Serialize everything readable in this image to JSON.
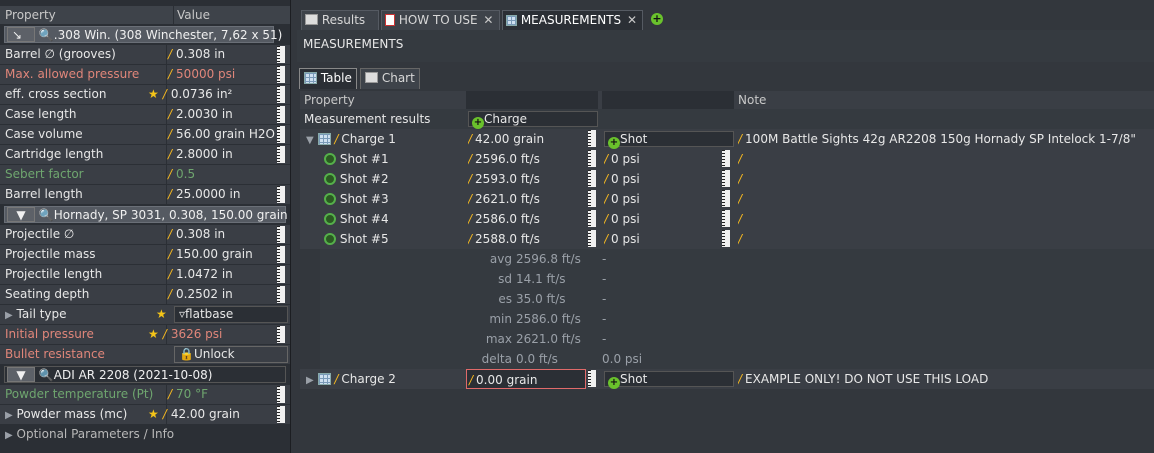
{
  "left": {
    "headers": {
      "property": "Property",
      "value": "Value"
    },
    "cartridge": {
      "label": ".308 Win. (308 Winchester, 7,62 x 51)"
    },
    "cartridge_rows": [
      {
        "name": "Barrel ∅ (grooves)",
        "value": "0.308 in"
      },
      {
        "name": "Max. allowed pressure",
        "value": "50000 psi"
      },
      {
        "name": "eff. cross section",
        "value": "0.0736 in²"
      },
      {
        "name": "Case length",
        "value": "2.0030 in"
      },
      {
        "name": "Case volume",
        "value": "56.00 grain H2O"
      },
      {
        "name": "Cartridge length",
        "value": "2.8000 in"
      },
      {
        "name": "Sebert factor",
        "value": "0.5"
      },
      {
        "name": "Barrel length",
        "value": "25.0000 in"
      }
    ],
    "projectile": {
      "label": "Hornady, SP 3031, 0.308, 150.00 grain"
    },
    "projectile_rows": [
      {
        "name": "Projectile ∅",
        "value": "0.308 in"
      },
      {
        "name": "Projectile mass",
        "value": "150.00 grain"
      },
      {
        "name": "Projectile length",
        "value": "1.0472 in"
      },
      {
        "name": "Seating depth",
        "value": "0.2502 in"
      }
    ],
    "tail_type": {
      "name": "Tail type",
      "value": "flatbase"
    },
    "initial_pressure": {
      "name": "Initial pressure",
      "value": "3626 psi"
    },
    "bullet_resistance": {
      "name": "Bullet resistance",
      "value": "Unlock"
    },
    "powder": {
      "label": "ADI AR 2208 (2021-10-08)"
    },
    "powder_temp": {
      "name": "Powder temperature (Pt)",
      "value": "70 °F"
    },
    "powder_mass": {
      "name": "Powder mass (mc)",
      "value": "42.00 grain"
    },
    "optional": "Optional Parameters / Info"
  },
  "tabs": [
    {
      "label": "Results"
    },
    {
      "label": "HOW TO USE"
    },
    {
      "label": "MEASUREMENTS"
    }
  ],
  "page_title": "MEASUREMENTS",
  "subtabs": [
    {
      "label": "Table"
    },
    {
      "label": "Chart"
    }
  ],
  "grid": {
    "headers": {
      "property": "Property",
      "note": "Note"
    },
    "measurement_results": "Measurement results",
    "add_charge": "Charge",
    "charge1": {
      "name": "Charge 1",
      "mass": "42.00 grain",
      "shot_btn": "Shot",
      "note": "100M Battle Sights 42g AR2208 150g Hornady SP Intelock  1-7/8\""
    },
    "shots": [
      {
        "name": "Shot #1",
        "velocity": "2596.0 ft/s",
        "pressure": "0 psi"
      },
      {
        "name": "Shot #2",
        "velocity": "2593.0 ft/s",
        "pressure": "0 psi"
      },
      {
        "name": "Shot #3",
        "velocity": "2621.0 ft/s",
        "pressure": "0 psi"
      },
      {
        "name": "Shot #4",
        "velocity": "2586.0 ft/s",
        "pressure": "0 psi"
      },
      {
        "name": "Shot #5",
        "velocity": "2588.0 ft/s",
        "pressure": "0 psi"
      }
    ],
    "stats": [
      {
        "label": "avg",
        "value": "2596.8 ft/s",
        "pressure": "-"
      },
      {
        "label": "sd",
        "value": "14.1 ft/s",
        "pressure": "-"
      },
      {
        "label": "es",
        "value": "35.0 ft/s",
        "pressure": "-"
      },
      {
        "label": "min",
        "value": "2586.0 ft/s",
        "pressure": "-"
      },
      {
        "label": "max",
        "value": "2621.0 ft/s",
        "pressure": "-"
      },
      {
        "label": "delta",
        "value": "0.0 ft/s",
        "pressure": "0.0 psi"
      }
    ],
    "charge2": {
      "name": "Charge 2",
      "mass": "0.00 grain",
      "shot_btn": "Shot",
      "note": "EXAMPLE ONLY! DO NOT USE THIS LOAD"
    }
  },
  "colors": {
    "accent_slash": "#f5b820",
    "add_green": "#6ac22c",
    "warning_red": "#e0867a"
  }
}
